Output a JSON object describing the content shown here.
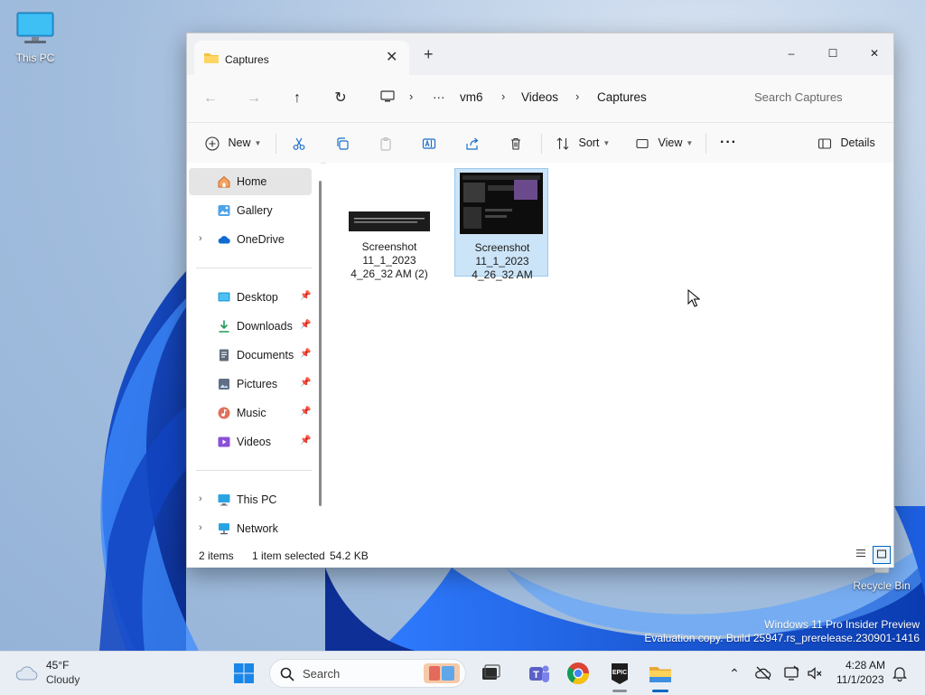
{
  "desktop": {
    "icons": [
      {
        "label": "This PC"
      },
      {
        "label": "Recycle Bin"
      }
    ],
    "watermark": {
      "line1": "Windows 11 Pro Insider Preview",
      "line2": "Evaluation copy. Build 25947.rs_prerelease.230901-1416"
    }
  },
  "window": {
    "tab_title": "Captures",
    "controls": {
      "minimize": "–",
      "maximize": "☐",
      "close": "✕"
    },
    "breadcrumbs": [
      "vm6",
      "Videos",
      "Captures"
    ],
    "search_placeholder": "Search Captures",
    "toolbar": {
      "new_label": "New",
      "sort_label": "Sort",
      "view_label": "View",
      "more_label": "···",
      "details_label": "Details"
    },
    "nav": {
      "items": [
        {
          "label": "Home",
          "icon": "home-icon",
          "selected": true
        },
        {
          "label": "Gallery",
          "icon": "gallery-icon"
        },
        {
          "label": "OneDrive",
          "icon": "onedrive-icon",
          "expandable": true
        },
        {
          "label": "Desktop",
          "icon": "desktop-folder-icon",
          "pinned": true
        },
        {
          "label": "Downloads",
          "icon": "downloads-icon",
          "pinned": true
        },
        {
          "label": "Documents",
          "icon": "documents-icon",
          "pinned": true
        },
        {
          "label": "Pictures",
          "icon": "pictures-icon",
          "pinned": true
        },
        {
          "label": "Music",
          "icon": "music-icon",
          "pinned": true
        },
        {
          "label": "Videos",
          "icon": "videos-icon",
          "pinned": true
        },
        {
          "label": "This PC",
          "icon": "this-pc-icon",
          "expandable": true
        },
        {
          "label": "Network",
          "icon": "network-icon",
          "expandable": true
        }
      ]
    },
    "files": [
      {
        "name_lines": [
          "Screenshot",
          "11_1_2023",
          "4_26_32 AM (2)"
        ],
        "selected": false
      },
      {
        "name_lines": [
          "Screenshot",
          "11_1_2023",
          "4_26_32 AM"
        ],
        "selected": true
      }
    ],
    "status": {
      "item_count": "2 items",
      "selection": "1 item selected",
      "size": "54.2 KB"
    }
  },
  "taskbar": {
    "weather": {
      "temp": "45°F",
      "desc": "Cloudy"
    },
    "search_label": "Search",
    "clock": {
      "time": "4:28 AM",
      "date": "11/1/2023"
    }
  },
  "colors": {
    "accent": "#0067c0",
    "selection_bg": "#cce4f7",
    "window_chrome": "#eef0f4"
  }
}
